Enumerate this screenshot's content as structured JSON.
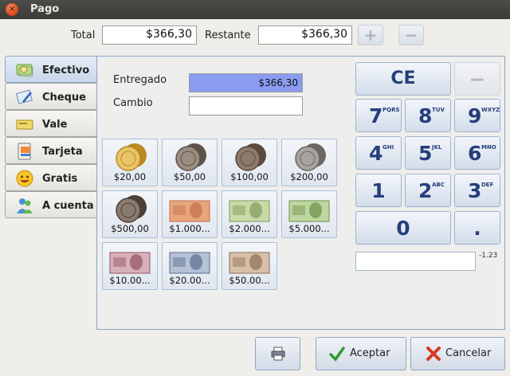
{
  "window": {
    "title": "Pago",
    "close_glyph": "×"
  },
  "header": {
    "total_label": "Total",
    "total_value": "$366,30",
    "remaining_label": "Restante",
    "remaining_value": "$366,30",
    "plus_glyph": "+",
    "minus_glyph": "−"
  },
  "tabs": [
    {
      "label": "Efectivo",
      "icon": "cash-icon",
      "selected": true
    },
    {
      "label": "Cheque",
      "icon": "cheque-icon",
      "selected": false
    },
    {
      "label": "Vale",
      "icon": "voucher-icon",
      "selected": false
    },
    {
      "label": "Tarjeta",
      "icon": "card-icon",
      "selected": false
    },
    {
      "label": "Gratis",
      "icon": "free-icon",
      "selected": false
    },
    {
      "label": "A cuenta",
      "icon": "account-icon",
      "selected": false
    }
  ],
  "cash": {
    "given_label": "Entregado",
    "given_value": "$366,30",
    "change_label": "Cambio",
    "change_value": ""
  },
  "denominations": [
    {
      "label": "$20,00",
      "kind": "coin"
    },
    {
      "label": "$50,00",
      "kind": "coin"
    },
    {
      "label": "$100,00",
      "kind": "coin"
    },
    {
      "label": "$200,00",
      "kind": "coin"
    },
    {
      "label": "$500,00",
      "kind": "coin"
    },
    {
      "label": "$1.000...",
      "kind": "bill"
    },
    {
      "label": "$2.000...",
      "kind": "bill"
    },
    {
      "label": "$5.000...",
      "kind": "bill"
    },
    {
      "label": "$10.00...",
      "kind": "bill"
    },
    {
      "label": "$20.00...",
      "kind": "bill"
    },
    {
      "label": "$50.00...",
      "kind": "bill"
    }
  ],
  "keypad": {
    "ce": "CE",
    "minus": "−",
    "k7": "7",
    "k7_sub": "PQRS",
    "k8": "8",
    "k8_sub": "TUV",
    "k9": "9",
    "k9_sub": "WXYZ",
    "k4": "4",
    "k4_sub": "GHI",
    "k5": "5",
    "k5_sub": "JKL",
    "k6": "6",
    "k6_sub": "MNO",
    "k1": "1",
    "k2": "2",
    "k2_sub": "ABC",
    "k3": "3",
    "k3_sub": "DEF",
    "k0": "0",
    "dot": ".",
    "display_value": "",
    "format_hint": "-1.23"
  },
  "footer": {
    "print_icon": "printer-icon",
    "accept_label": "Aceptar",
    "cancel_label": "Cancelar"
  },
  "colors": {
    "accent": "#8a9cf0",
    "selected_tab": "#c8d6ea",
    "key_text": "#263f7a"
  }
}
